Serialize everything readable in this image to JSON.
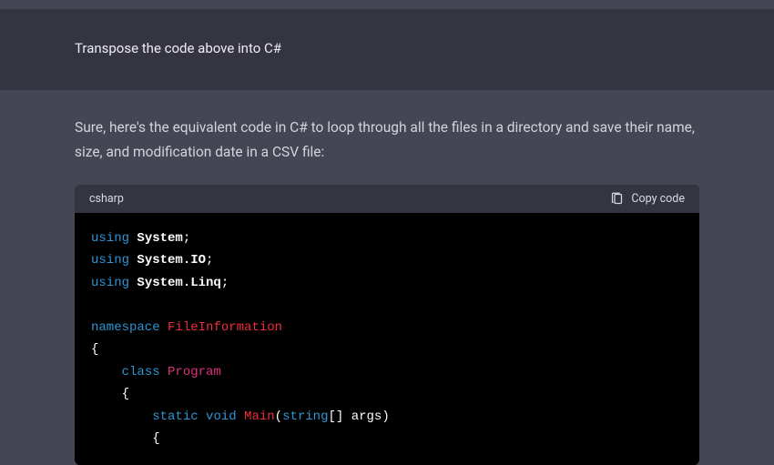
{
  "user_message": {
    "text": "Transpose the code above into C#"
  },
  "assistant_message": {
    "intro": "Sure, here's the equivalent code in C# to loop through all the files in a directory and save their name, size, and modification date in a CSV file:"
  },
  "code_block": {
    "language": "csharp",
    "copy_label": "Copy code",
    "tokens": {
      "using": "using",
      "namespace_kw": "namespace",
      "class_kw": "class",
      "static_kw": "static",
      "void_kw": "void",
      "string_kw": "string",
      "system": "System",
      "system_io": "System.IO",
      "system_linq": "System.Linq",
      "ns_name": "FileInformation",
      "class_name": "Program",
      "method_name": "Main",
      "args_name": "args",
      "lbrace": "{",
      "rbrace": "}",
      "lparen": "(",
      "rparen": ")",
      "brackets": "[]",
      "semi": ";"
    }
  }
}
